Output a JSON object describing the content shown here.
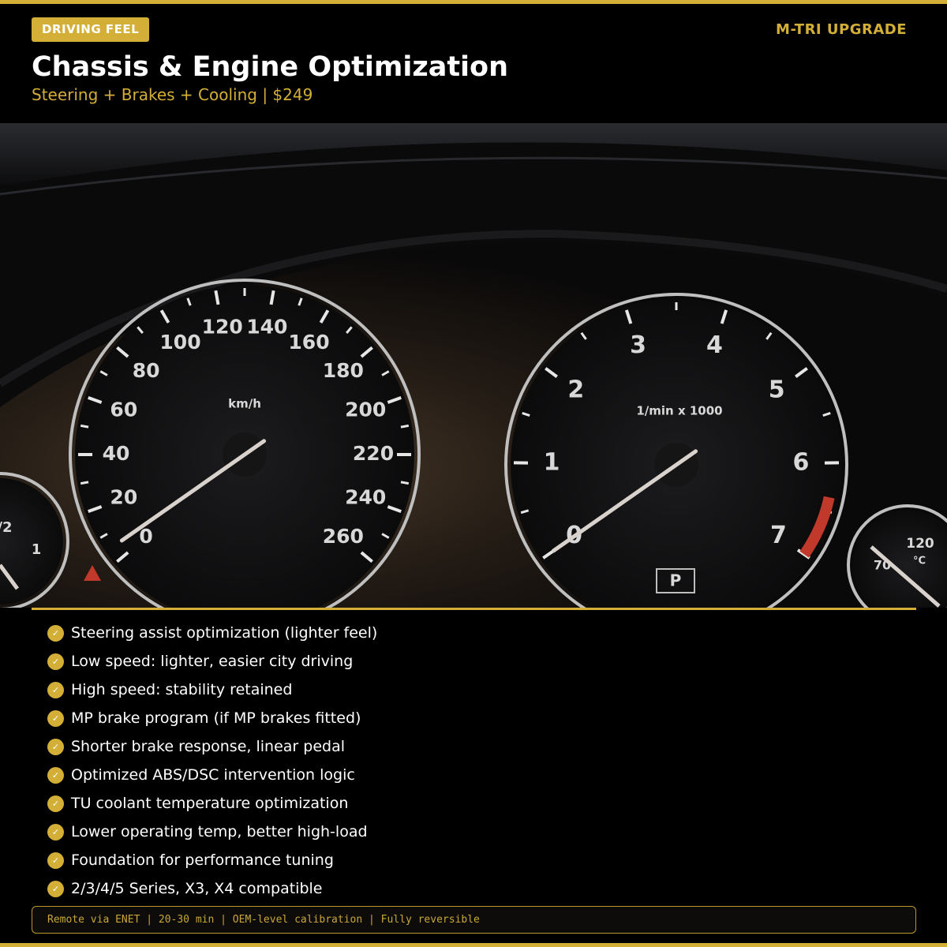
{
  "header": {
    "badge": "DRIVING FEEL",
    "brand": "M-TRI UPGRADE",
    "title": "Chassis & Engine Optimization",
    "subtitle": "Steering + Brakes + Cooling | $249"
  },
  "photo": {
    "speedometer_unit": "km/h",
    "speedometer_labels": [
      "0",
      "20",
      "40",
      "60",
      "80",
      "100",
      "120",
      "140",
      "160",
      "180",
      "200",
      "220",
      "240",
      "260"
    ],
    "tachometer_unit": "1/min x 1000",
    "tachometer_labels": [
      "0",
      "1",
      "2",
      "3",
      "4",
      "5",
      "6",
      "7"
    ],
    "gear_indicator": "P",
    "left_gauge_labels": [
      "/2",
      "1"
    ],
    "temp_gauge_labels": [
      "70",
      "120",
      "°C"
    ]
  },
  "features": [
    "Steering assist optimization (lighter feel)",
    "Low speed: lighter, easier city driving",
    "High speed: stability retained",
    "MP brake program (if MP brakes fitted)",
    "Shorter brake response, linear pedal",
    "Optimized ABS/DSC intervention logic",
    "TU coolant temperature optimization",
    "Lower operating temp, better high-load",
    "Foundation for performance tuning",
    "2/3/4/5 Series, X3, X4 compatible"
  ],
  "footer": {
    "text": "Remote via ENET | 20-30 min | OEM-level calibration | Fully reversible"
  },
  "colors": {
    "accent": "#d4af37",
    "background": "#000000",
    "text": "#ffffff",
    "redline": "#c0392b"
  },
  "icons": {
    "feature_bullet": "check-icon",
    "warning": "warning-triangle-icon"
  }
}
